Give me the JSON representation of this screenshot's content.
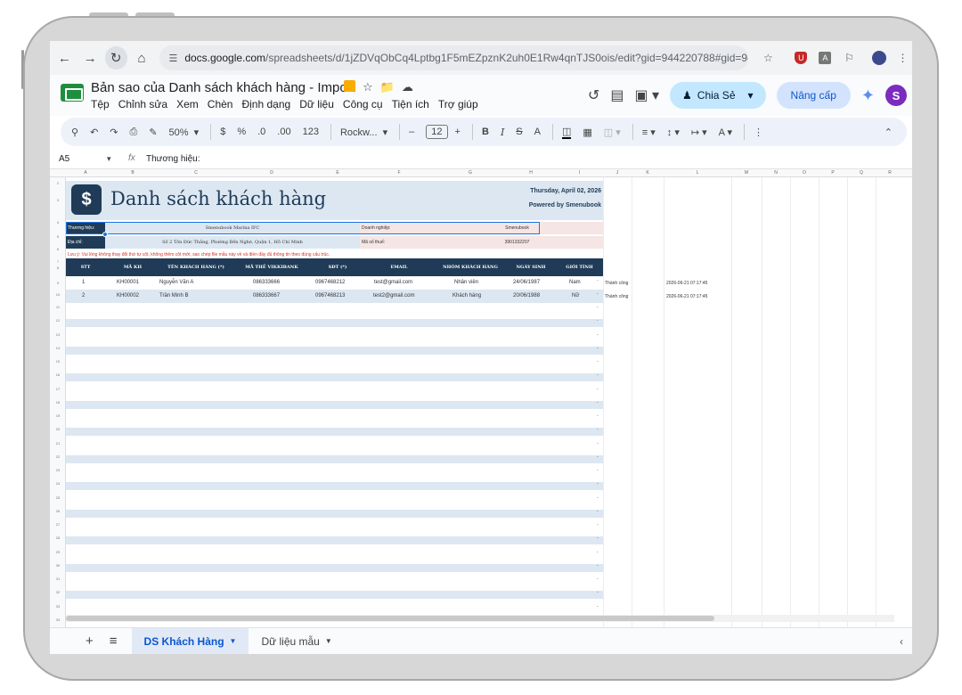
{
  "browser": {
    "url_host": "docs.google.com",
    "url_path": "/spreadsheets/d/1jZDVqObCq4Lptbg1F5mEZpznK2uh0E1Rw4qnTJS0ois/edit?gid=944220788#gid=944220788"
  },
  "doc": {
    "title": "Bản sao của Danh sách khách hàng - Import",
    "menus": [
      "Tệp",
      "Chỉnh sửa",
      "Xem",
      "Chèn",
      "Định dạng",
      "Dữ liệu",
      "Công cụ",
      "Tiện ích",
      "Trợ giúp"
    ],
    "share_label": "Chia Sẻ",
    "upgrade_label": "Nâng cấp"
  },
  "toolbar": {
    "zoom": "50%",
    "currency": "$",
    "percent": "%",
    "dec_less": ".0",
    "dec_more": ".00",
    "number_format": "123",
    "font": "Rockw...",
    "font_size": "12"
  },
  "formula_bar": {
    "cell_ref": "A5",
    "value": "Thương hiệu:"
  },
  "sheet": {
    "title": "Danh sách khách hàng",
    "date": "Thursday, April 02, 2026",
    "powered": "Powered by Smenubook",
    "brand_label": "Thương hiệu:",
    "brand_value": "Smenubook Marina IFC",
    "company_label": "Doanh nghiệp:",
    "company_value": "Smenubook",
    "address_label": "Địa chỉ:",
    "address_value": "Số 2 Tôn Đức Thắng, Phường Bến Nghé, Quận 1, Hồ Chí Minh",
    "tax_label": "Mã số thuế:",
    "tax_value": "3901332207",
    "note": "Lưu ý: Vui lòng không thay đổi thứ tự cột, không thêm cột mới, sao chép file mẫu này về và điền đầy đủ thông tin theo đúng cấu trúc.",
    "headers": [
      "STT",
      "MÃ KH",
      "TÊN KHÁCH HÀNG (*)",
      "MÃ THẺ VIKKIBANK",
      "SĐT (*)",
      "EMAIL",
      "NHÓM KHÁCH HÀNG",
      "NGÀY SINH",
      "GIỚI TÍNH"
    ],
    "rows": [
      {
        "stt": "1",
        "code": "KH00001",
        "name": "Nguyễn Văn A",
        "card": "086333666",
        "phone": "0967468212",
        "email": "test@gmail.com",
        "group": "Nhân viên",
        "dob": "24/06/1987",
        "gender": "Nam",
        "status": "Thành công",
        "time": "2026-06-21 07:17:45"
      },
      {
        "stt": "2",
        "code": "KH00002",
        "name": "Trần Minh B",
        "card": "086333667",
        "phone": "0967468213",
        "email": "test2@gmail.com",
        "group": "Khách hàng",
        "dob": "20/06/1988",
        "gender": "Nữ",
        "status": "Thành công",
        "time": "2026-06-21 07:17:45"
      }
    ],
    "empty_marker": "-"
  },
  "columns": [
    "A",
    "B",
    "C",
    "D",
    "E",
    "F",
    "G",
    "H",
    "I",
    "J",
    "K",
    "L",
    "M",
    "N",
    "O",
    "P",
    "Q",
    "R"
  ],
  "row_numbers": [
    "2",
    "3",
    "4",
    "5",
    "6",
    "7",
    "8",
    "9",
    "10",
    "11",
    "12",
    "13",
    "14",
    "15",
    "16",
    "17",
    "18",
    "19",
    "20",
    "21",
    "22",
    "23",
    "24",
    "25",
    "26",
    "27",
    "28",
    "29",
    "30",
    "31",
    "32",
    "33",
    "34",
    "35",
    "36"
  ],
  "tabs": {
    "active": "DS Khách Hàng",
    "other": "Dữ liệu mẫu"
  },
  "colors": {
    "accent": "#1f3b57",
    "band": "#dce7f2",
    "note": "#d93025",
    "share_bg": "#c2e7ff"
  }
}
